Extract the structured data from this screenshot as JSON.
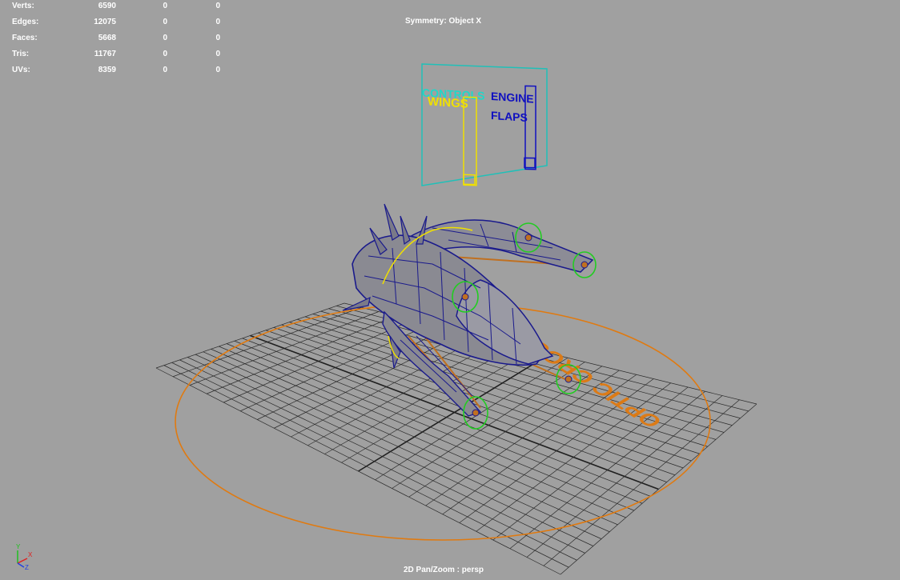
{
  "hud": {
    "rows": [
      {
        "label": "Verts:",
        "v1": "6590",
        "v2": "0",
        "v3": "0"
      },
      {
        "label": "Edges:",
        "v1": "12075",
        "v2": "0",
        "v3": "0"
      },
      {
        "label": "Faces:",
        "v1": "5668",
        "v2": "0",
        "v3": "0"
      },
      {
        "label": "Tris:",
        "v1": "11767",
        "v2": "0",
        "v3": "0"
      },
      {
        "label": "UVs:",
        "v1": "8359",
        "v2": "0",
        "v3": "0"
      }
    ]
  },
  "symmetry": "Symmetry: Object X",
  "camera": "2D Pan/Zoom : persp",
  "controls_panel": {
    "title": "CONTROLS",
    "wings": "WINGS",
    "engine_line1": "ENGINE",
    "engine_line2": "FLAPS"
  },
  "floor_text": "OPTIC CROSS",
  "axis": {
    "y": "Y",
    "x": "X",
    "z": "Z"
  },
  "colors": {
    "background": "#a0a0a0",
    "grid": "#2a2a2a",
    "wireframe": "#1a1a8c",
    "model_fill": "#8a8a92",
    "root_control": "#e07a10",
    "engine_control": "#22cc22",
    "controls_frame": "#20c0b8",
    "wings_text": "#f0e000",
    "engine_text": "#1010c0"
  }
}
